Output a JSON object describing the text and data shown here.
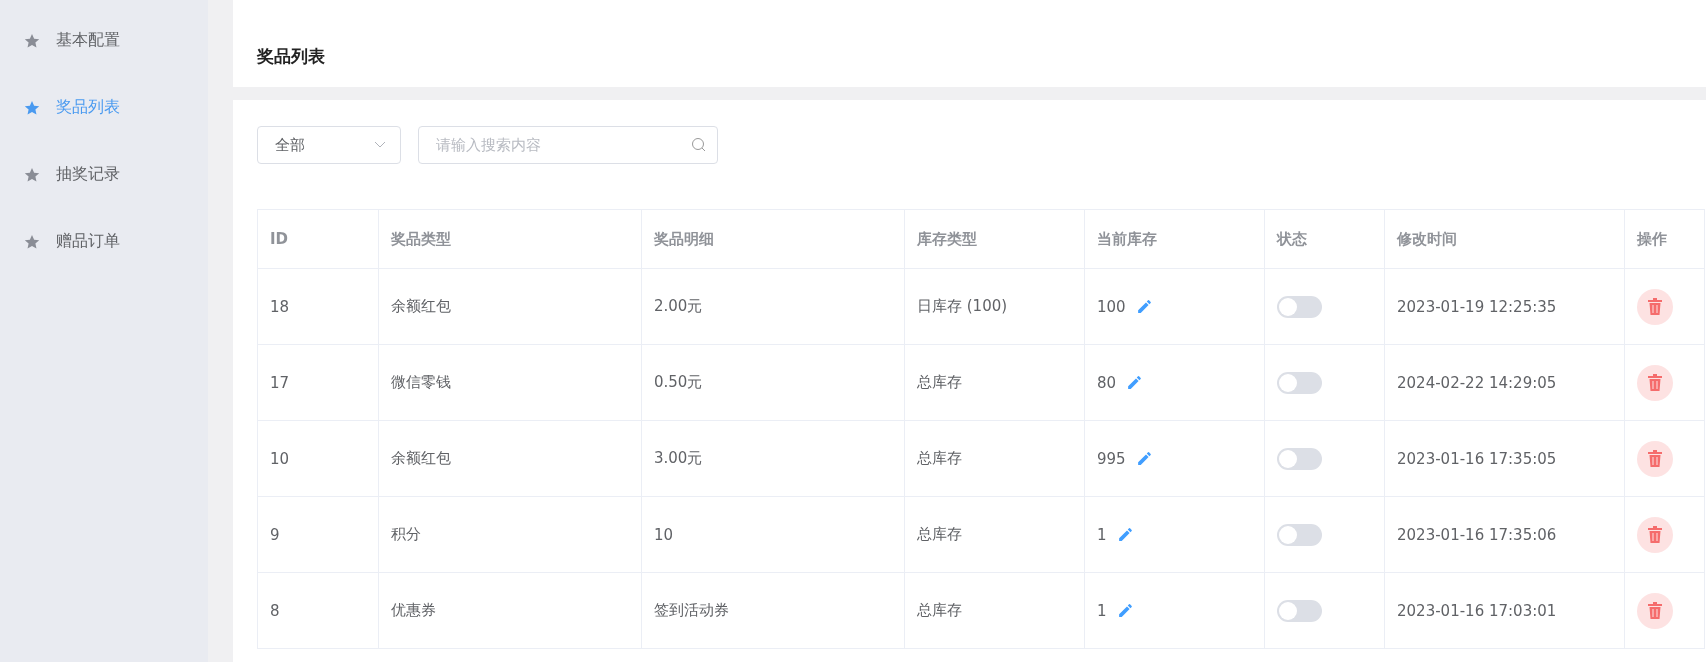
{
  "sidebar": {
    "items": [
      {
        "label": "基本配置",
        "selected": false
      },
      {
        "label": "奖品列表",
        "selected": true
      },
      {
        "label": "抽奖记录",
        "selected": false
      },
      {
        "label": "赠品订单",
        "selected": false
      }
    ]
  },
  "header": {
    "title": "奖品列表"
  },
  "filters": {
    "type_select": {
      "value": "全部"
    },
    "search": {
      "placeholder": "请输入搜索内容"
    }
  },
  "table": {
    "columns": [
      "ID",
      "奖品类型",
      "奖品明细",
      "库存类型",
      "当前库存",
      "状态",
      "修改时间",
      "操作"
    ],
    "rows": [
      {
        "id": "18",
        "prize_type": "余额红包",
        "detail": "2.00元",
        "stock_type": "日库存 (100)",
        "stock": "100",
        "on": false,
        "modified": "2023-01-19 12:25:35"
      },
      {
        "id": "17",
        "prize_type": "微信零钱",
        "detail": "0.50元",
        "stock_type": "总库存",
        "stock": "80",
        "on": false,
        "modified": "2024-02-22 14:29:05"
      },
      {
        "id": "10",
        "prize_type": "余额红包",
        "detail": "3.00元",
        "stock_type": "总库存",
        "stock": "995",
        "on": false,
        "modified": "2023-01-16 17:35:05"
      },
      {
        "id": "9",
        "prize_type": "积分",
        "detail": "10",
        "stock_type": "总库存",
        "stock": "1",
        "on": false,
        "modified": "2023-01-16 17:35:06"
      },
      {
        "id": "8",
        "prize_type": "优惠券",
        "detail": "签到活动券",
        "stock_type": "总库存",
        "stock": "1",
        "on": false,
        "modified": "2023-01-16 17:03:01"
      }
    ]
  }
}
